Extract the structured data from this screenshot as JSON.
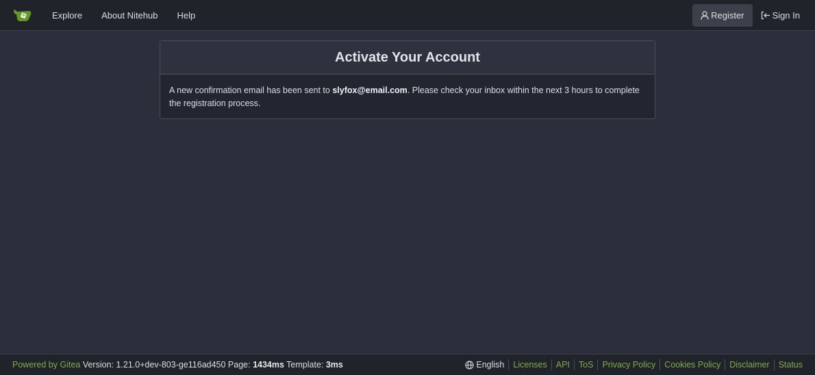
{
  "nav": {
    "items": [
      "Explore",
      "About Nitehub",
      "Help"
    ],
    "register_label": "Register",
    "signin_label": "Sign In"
  },
  "card": {
    "title": "Activate Your Account",
    "message_prefix": "A new confirmation email has been sent to ",
    "email": "slyfox@email.com",
    "message_suffix": ". Please check your inbox within the next 3 hours to complete the registration process."
  },
  "footer": {
    "powered_by": "Powered by Gitea",
    "version_label": " Version: 1.21.0+dev-803-ge116ad450 Page: ",
    "page_time": "1434ms",
    "template_label": " Template: ",
    "template_time": "3ms",
    "language": "English",
    "links": [
      "Licenses",
      "API",
      "ToS",
      "Privacy Policy",
      "Cookies Policy",
      "Disclaimer",
      "Status"
    ]
  },
  "colors": {
    "accent": "#7fae48",
    "background": "#2c2f3b",
    "navbar": "#202329"
  }
}
